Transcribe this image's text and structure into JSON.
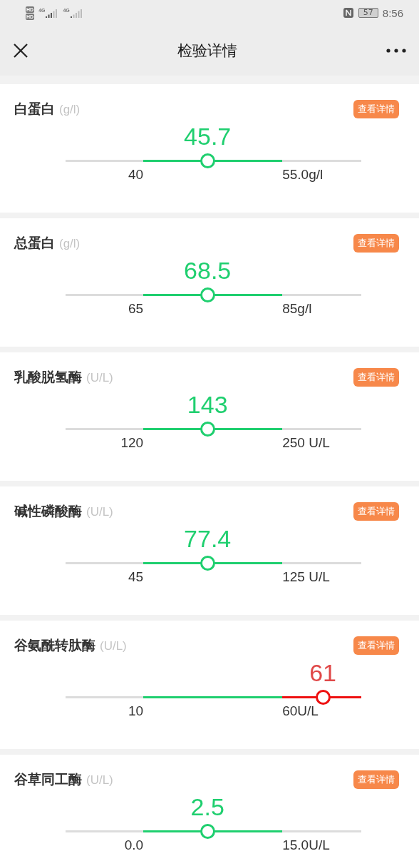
{
  "status_bar": {
    "sim_labels": [
      "HD",
      "HD"
    ],
    "network_labels": [
      "4G",
      "4G"
    ],
    "battery": "57",
    "time": "8:56"
  },
  "nav": {
    "title": "检验详情"
  },
  "items": [
    {
      "name": "白蛋白",
      "unit": "(g/l)",
      "button": "查看详情",
      "value": "45.7",
      "high": false,
      "level": 0.48,
      "min": "40",
      "max": "55.0g/l"
    },
    {
      "name": "总蛋白",
      "unit": "(g/l)",
      "button": "查看详情",
      "value": "68.5",
      "high": false,
      "level": 0.48,
      "min": "65",
      "max": "85g/l"
    },
    {
      "name": "乳酸脱氢酶",
      "unit": "(U/L)",
      "button": "查看详情",
      "value": "143",
      "high": false,
      "level": 0.48,
      "min": "120",
      "max": "250 U/L"
    },
    {
      "name": "碱性磷酸酶",
      "unit": "(U/L)",
      "button": "查看详情",
      "value": "77.4",
      "high": false,
      "level": 0.48,
      "min": "45",
      "max": "125 U/L"
    },
    {
      "name": "谷氨酰转肽酶",
      "unit": "(U/L)",
      "button": "查看详情",
      "value": "61",
      "high": true,
      "level": 0.87,
      "min": "10",
      "max": "60U/L"
    },
    {
      "name": "谷草同工酶",
      "unit": "(U/L)",
      "button": "查看详情",
      "value": "2.5",
      "high": false,
      "level": 0.48,
      "min": "0.0",
      "max": "15.0U/L"
    }
  ]
}
